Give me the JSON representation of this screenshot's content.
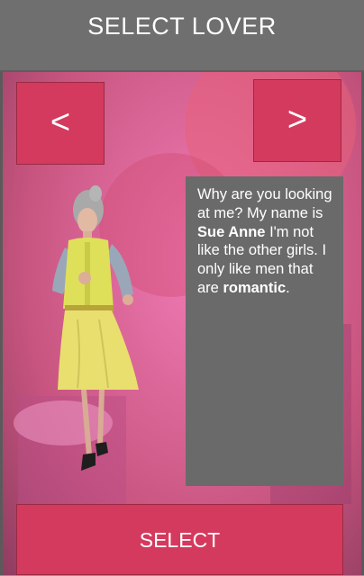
{
  "header": {
    "title": "SELECT LOVER"
  },
  "nav": {
    "prev_label": "<",
    "next_label": ">"
  },
  "dialogue": {
    "part1": "Why are you looking at me? My name is ",
    "name": "Sue Anne",
    "part2": " I'm not like the other girls. I only like men that are ",
    "trait": "romantic",
    "part3": "."
  },
  "actions": {
    "select_label": "SELECT"
  },
  "colors": {
    "header_bg": "#6f6f6f",
    "button_bg": "#d43a5e",
    "bubble_bg": "#6a6a6a",
    "background_tint": "#e06aa8"
  }
}
